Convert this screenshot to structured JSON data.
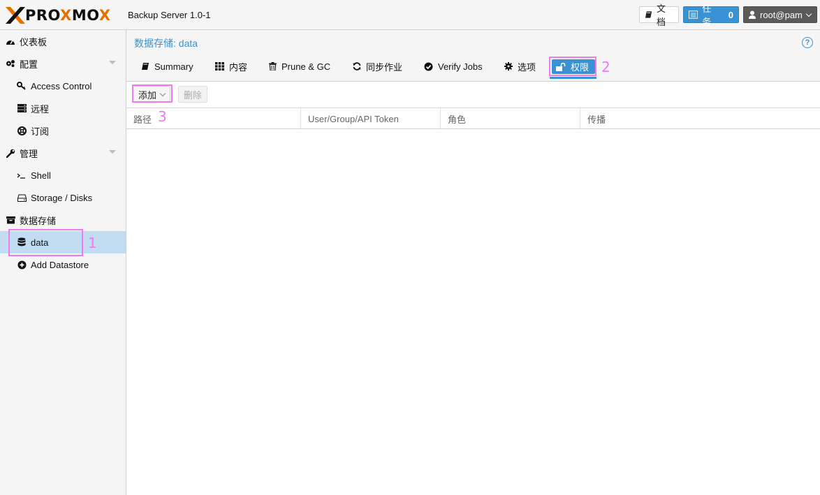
{
  "header": {
    "logo_text_1": "PRO",
    "logo_text_x": "X",
    "logo_text_2": "MO",
    "logo_text_3": "X",
    "version": "Backup Server 1.0-1",
    "docs_label": "文档",
    "tasks_label": "任务",
    "tasks_count": "0",
    "user_label": "root@pam"
  },
  "sidebar": {
    "items": [
      {
        "label": "仪表板",
        "icon": "dashboard-icon"
      },
      {
        "label": "配置",
        "icon": "gears-icon"
      },
      {
        "label": "Access Control",
        "icon": "key-icon"
      },
      {
        "label": "远程",
        "icon": "server-icon"
      },
      {
        "label": "订阅",
        "icon": "support-icon"
      },
      {
        "label": "管理",
        "icon": "wrench-icon"
      },
      {
        "label": "Shell",
        "icon": "terminal-icon"
      },
      {
        "label": "Storage / Disks",
        "icon": "hdd-icon"
      },
      {
        "label": "数据存储",
        "icon": "archive-icon"
      },
      {
        "label": "data",
        "icon": "database-icon"
      },
      {
        "label": "Add Datastore",
        "icon": "plus-circle-icon"
      }
    ]
  },
  "main": {
    "title": "数据存储: data",
    "tabs": [
      {
        "label": "Summary",
        "icon": "book-icon"
      },
      {
        "label": "内容",
        "icon": "grid-icon"
      },
      {
        "label": "Prune & GC",
        "icon": "trash-icon"
      },
      {
        "label": "同步作业",
        "icon": "refresh-icon"
      },
      {
        "label": "Verify Jobs",
        "icon": "check-circle-icon"
      },
      {
        "label": "选项",
        "icon": "gear-icon"
      },
      {
        "label": "权限",
        "icon": "unlock-icon"
      }
    ],
    "toolbar": {
      "add_label": "添加",
      "remove_label": "删除"
    },
    "grid": {
      "columns": [
        "路径",
        "User/Group/API Token",
        "角色",
        "传播"
      ],
      "rows": []
    }
  },
  "annotations": {
    "one": "1",
    "two": "2",
    "three": "3"
  },
  "colors": {
    "accent": "#3892d4",
    "selected_row": "#c2ddf2",
    "annotation": "#f07af2",
    "logo_orange": "#e57000"
  }
}
